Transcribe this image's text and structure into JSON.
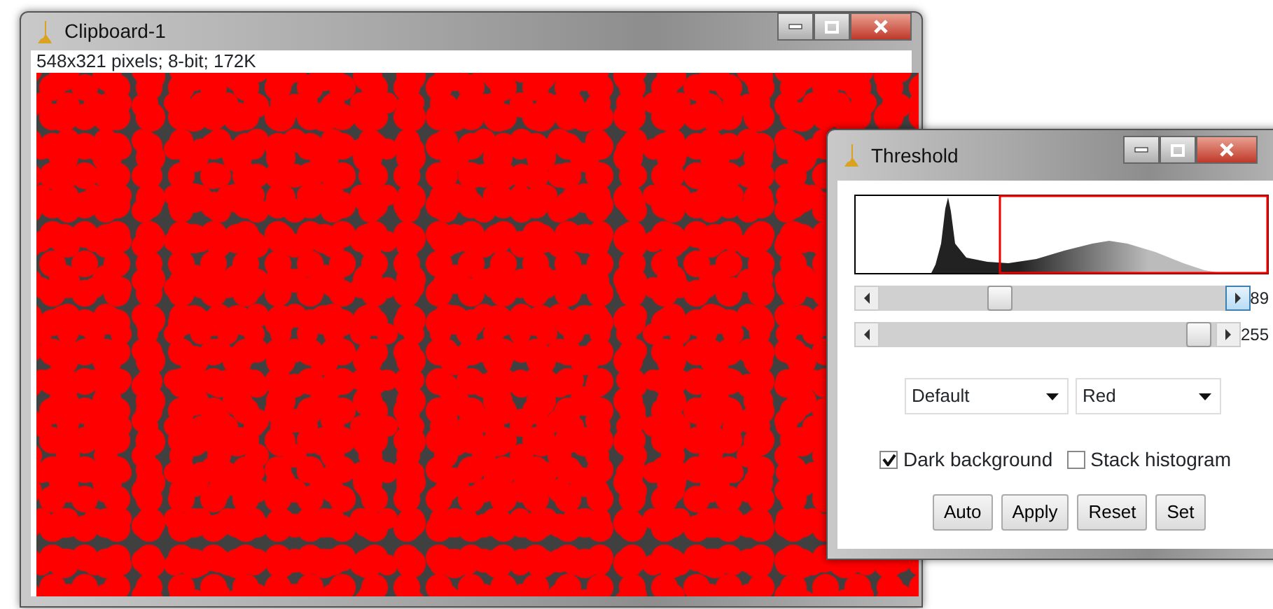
{
  "image_window": {
    "title": "Clipboard-1",
    "info": "548x321 pixels; 8-bit; 172K"
  },
  "threshold_window": {
    "title": "Threshold",
    "sliders": [
      {
        "level": 0.35,
        "reading": "89",
        "right_arrow_hovered": true
      },
      {
        "level": 1.0,
        "reading": "255",
        "right_arrow_hovered": false
      }
    ],
    "dropdowns": [
      {
        "value": "Default"
      },
      {
        "value": "Red"
      }
    ],
    "checkboxes": [
      {
        "label": "Dark background",
        "checked": true
      },
      {
        "label": "Stack histogram",
        "checked": false
      }
    ],
    "buttons": [
      "Auto",
      "Apply",
      "Reset",
      "Set"
    ]
  }
}
